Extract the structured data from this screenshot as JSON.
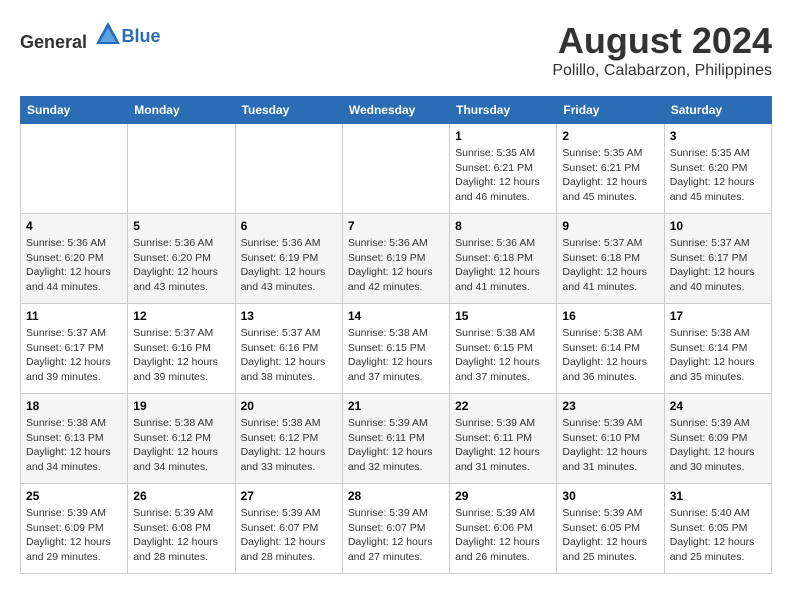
{
  "header": {
    "logo": {
      "general": "General",
      "blue": "Blue"
    },
    "month_year": "August 2024",
    "location": "Polillo, Calabarzon, Philippines"
  },
  "days_of_week": [
    "Sunday",
    "Monday",
    "Tuesday",
    "Wednesday",
    "Thursday",
    "Friday",
    "Saturday"
  ],
  "weeks": [
    [
      {
        "day": "",
        "info": ""
      },
      {
        "day": "",
        "info": ""
      },
      {
        "day": "",
        "info": ""
      },
      {
        "day": "",
        "info": ""
      },
      {
        "day": "1",
        "info": "Sunrise: 5:35 AM\nSunset: 6:21 PM\nDaylight: 12 hours\nand 46 minutes."
      },
      {
        "day": "2",
        "info": "Sunrise: 5:35 AM\nSunset: 6:21 PM\nDaylight: 12 hours\nand 45 minutes."
      },
      {
        "day": "3",
        "info": "Sunrise: 5:35 AM\nSunset: 6:20 PM\nDaylight: 12 hours\nand 45 minutes."
      }
    ],
    [
      {
        "day": "4",
        "info": "Sunrise: 5:36 AM\nSunset: 6:20 PM\nDaylight: 12 hours\nand 44 minutes."
      },
      {
        "day": "5",
        "info": "Sunrise: 5:36 AM\nSunset: 6:20 PM\nDaylight: 12 hours\nand 43 minutes."
      },
      {
        "day": "6",
        "info": "Sunrise: 5:36 AM\nSunset: 6:19 PM\nDaylight: 12 hours\nand 43 minutes."
      },
      {
        "day": "7",
        "info": "Sunrise: 5:36 AM\nSunset: 6:19 PM\nDaylight: 12 hours\nand 42 minutes."
      },
      {
        "day": "8",
        "info": "Sunrise: 5:36 AM\nSunset: 6:18 PM\nDaylight: 12 hours\nand 41 minutes."
      },
      {
        "day": "9",
        "info": "Sunrise: 5:37 AM\nSunset: 6:18 PM\nDaylight: 12 hours\nand 41 minutes."
      },
      {
        "day": "10",
        "info": "Sunrise: 5:37 AM\nSunset: 6:17 PM\nDaylight: 12 hours\nand 40 minutes."
      }
    ],
    [
      {
        "day": "11",
        "info": "Sunrise: 5:37 AM\nSunset: 6:17 PM\nDaylight: 12 hours\nand 39 minutes."
      },
      {
        "day": "12",
        "info": "Sunrise: 5:37 AM\nSunset: 6:16 PM\nDaylight: 12 hours\nand 39 minutes."
      },
      {
        "day": "13",
        "info": "Sunrise: 5:37 AM\nSunset: 6:16 PM\nDaylight: 12 hours\nand 38 minutes."
      },
      {
        "day": "14",
        "info": "Sunrise: 5:38 AM\nSunset: 6:15 PM\nDaylight: 12 hours\nand 37 minutes."
      },
      {
        "day": "15",
        "info": "Sunrise: 5:38 AM\nSunset: 6:15 PM\nDaylight: 12 hours\nand 37 minutes."
      },
      {
        "day": "16",
        "info": "Sunrise: 5:38 AM\nSunset: 6:14 PM\nDaylight: 12 hours\nand 36 minutes."
      },
      {
        "day": "17",
        "info": "Sunrise: 5:38 AM\nSunset: 6:14 PM\nDaylight: 12 hours\nand 35 minutes."
      }
    ],
    [
      {
        "day": "18",
        "info": "Sunrise: 5:38 AM\nSunset: 6:13 PM\nDaylight: 12 hours\nand 34 minutes."
      },
      {
        "day": "19",
        "info": "Sunrise: 5:38 AM\nSunset: 6:12 PM\nDaylight: 12 hours\nand 34 minutes."
      },
      {
        "day": "20",
        "info": "Sunrise: 5:38 AM\nSunset: 6:12 PM\nDaylight: 12 hours\nand 33 minutes."
      },
      {
        "day": "21",
        "info": "Sunrise: 5:39 AM\nSunset: 6:11 PM\nDaylight: 12 hours\nand 32 minutes."
      },
      {
        "day": "22",
        "info": "Sunrise: 5:39 AM\nSunset: 6:11 PM\nDaylight: 12 hours\nand 31 minutes."
      },
      {
        "day": "23",
        "info": "Sunrise: 5:39 AM\nSunset: 6:10 PM\nDaylight: 12 hours\nand 31 minutes."
      },
      {
        "day": "24",
        "info": "Sunrise: 5:39 AM\nSunset: 6:09 PM\nDaylight: 12 hours\nand 30 minutes."
      }
    ],
    [
      {
        "day": "25",
        "info": "Sunrise: 5:39 AM\nSunset: 6:09 PM\nDaylight: 12 hours\nand 29 minutes."
      },
      {
        "day": "26",
        "info": "Sunrise: 5:39 AM\nSunset: 6:08 PM\nDaylight: 12 hours\nand 28 minutes."
      },
      {
        "day": "27",
        "info": "Sunrise: 5:39 AM\nSunset: 6:07 PM\nDaylight: 12 hours\nand 28 minutes."
      },
      {
        "day": "28",
        "info": "Sunrise: 5:39 AM\nSunset: 6:07 PM\nDaylight: 12 hours\nand 27 minutes."
      },
      {
        "day": "29",
        "info": "Sunrise: 5:39 AM\nSunset: 6:06 PM\nDaylight: 12 hours\nand 26 minutes."
      },
      {
        "day": "30",
        "info": "Sunrise: 5:39 AM\nSunset: 6:05 PM\nDaylight: 12 hours\nand 25 minutes."
      },
      {
        "day": "31",
        "info": "Sunrise: 5:40 AM\nSunset: 6:05 PM\nDaylight: 12 hours\nand 25 minutes."
      }
    ]
  ]
}
